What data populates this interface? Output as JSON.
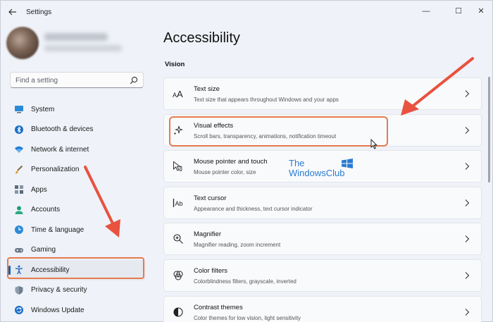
{
  "window": {
    "title": "Settings",
    "controls": {
      "minimize": "—",
      "maximize": "☐",
      "close": "✕"
    }
  },
  "search": {
    "placeholder": "Find a setting"
  },
  "sidebar": {
    "items": [
      {
        "label": "System",
        "icon": "monitor-icon"
      },
      {
        "label": "Bluetooth & devices",
        "icon": "bluetooth-icon"
      },
      {
        "label": "Network & internet",
        "icon": "wifi-icon"
      },
      {
        "label": "Personalization",
        "icon": "brush-icon"
      },
      {
        "label": "Apps",
        "icon": "apps-grid-icon"
      },
      {
        "label": "Accounts",
        "icon": "person-icon"
      },
      {
        "label": "Time & language",
        "icon": "globe-clock-icon"
      },
      {
        "label": "Gaming",
        "icon": "gamepad-icon"
      },
      {
        "label": "Accessibility",
        "icon": "accessibility-icon",
        "selected": true
      },
      {
        "label": "Privacy & security",
        "icon": "shield-icon"
      },
      {
        "label": "Windows Update",
        "icon": "update-icon"
      }
    ]
  },
  "main": {
    "title": "Accessibility",
    "section": "Vision",
    "cards": [
      {
        "title": "Text size",
        "description": "Text size that appears throughout Windows and your apps",
        "icon": "text-size-icon"
      },
      {
        "title": "Visual effects",
        "description": "Scroll bars, transparency, animations, notification timeout",
        "icon": "sparkle-icon",
        "highlighted": true
      },
      {
        "title": "Mouse pointer and touch",
        "description": "Mouse pointer color, size",
        "icon": "mouse-pointer-icon"
      },
      {
        "title": "Text cursor",
        "description": "Appearance and thickness, text cursor indicator",
        "icon": "text-cursor-icon"
      },
      {
        "title": "Magnifier",
        "description": "Magnifier reading, zoom increment",
        "icon": "magnifier-icon"
      },
      {
        "title": "Color filters",
        "description": "Colorblindness filters, grayscale, inverted",
        "icon": "color-filter-icon"
      },
      {
        "title": "Contrast themes",
        "description": "Color themes for low vision, light sensitivity",
        "icon": "contrast-icon"
      }
    ]
  },
  "watermark": {
    "line1": "The",
    "line2": "WindowsClub"
  },
  "colors": {
    "accent": "#0a5fb5",
    "annotation": "#e8523f",
    "highlight_box": "#e67a4d",
    "watermark": "#2a7bd1"
  }
}
